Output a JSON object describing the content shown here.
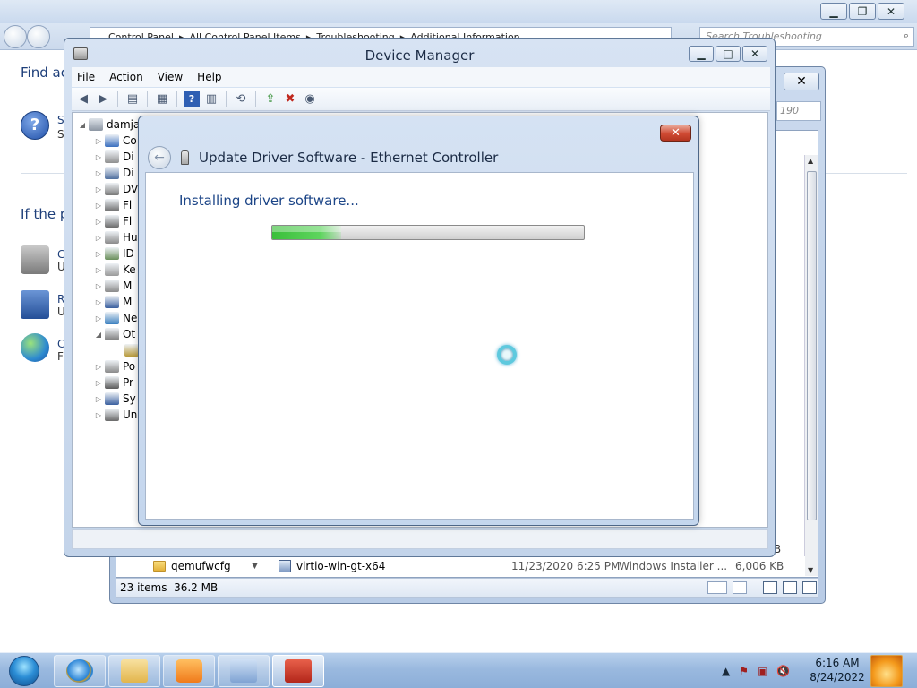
{
  "control_panel": {
    "breadcrumb": [
      "Control Panel",
      "All Control Panel Items",
      "Troubleshooting",
      "Additional Information"
    ],
    "search_placeholder": "Search Troubleshooting",
    "heading_fragment": "Find ac",
    "para_fragment": "If the p",
    "item_letters": [
      [
        "S",
        "S"
      ],
      [
        "G",
        "U"
      ],
      [
        "R",
        "U"
      ],
      [
        "C",
        "F"
      ]
    ]
  },
  "explorer": {
    "search_fragment": "190",
    "size_fragment": "KB",
    "file_row": {
      "folder": "qemufwcfg",
      "name": "virtio-win-gt-x64",
      "date": "11/23/2020 6:25 PM",
      "type": "Windows Installer ...",
      "size": "6,006 KB"
    },
    "status": {
      "items": "23 items",
      "size": "36.2 MB"
    }
  },
  "device_manager": {
    "title": "Device Manager",
    "menu": [
      "File",
      "Action",
      "View",
      "Help"
    ],
    "root": "damja",
    "tree_fragments": [
      "Co",
      "Di",
      "Di",
      "DV",
      "Fl",
      "Fl",
      "Hu",
      "ID",
      "Ke",
      "M",
      "M",
      "Ne",
      "Ot",
      "",
      "Po",
      "Pr",
      "Sy",
      "Un"
    ]
  },
  "dialog": {
    "title": "Update Driver Software - Ethernet Controller",
    "status": "Installing driver software...",
    "progress_fraction": 0.22,
    "close_glyph": "✕"
  },
  "taskbar": {
    "time": "6:16 AM",
    "date": "8/24/2022"
  }
}
